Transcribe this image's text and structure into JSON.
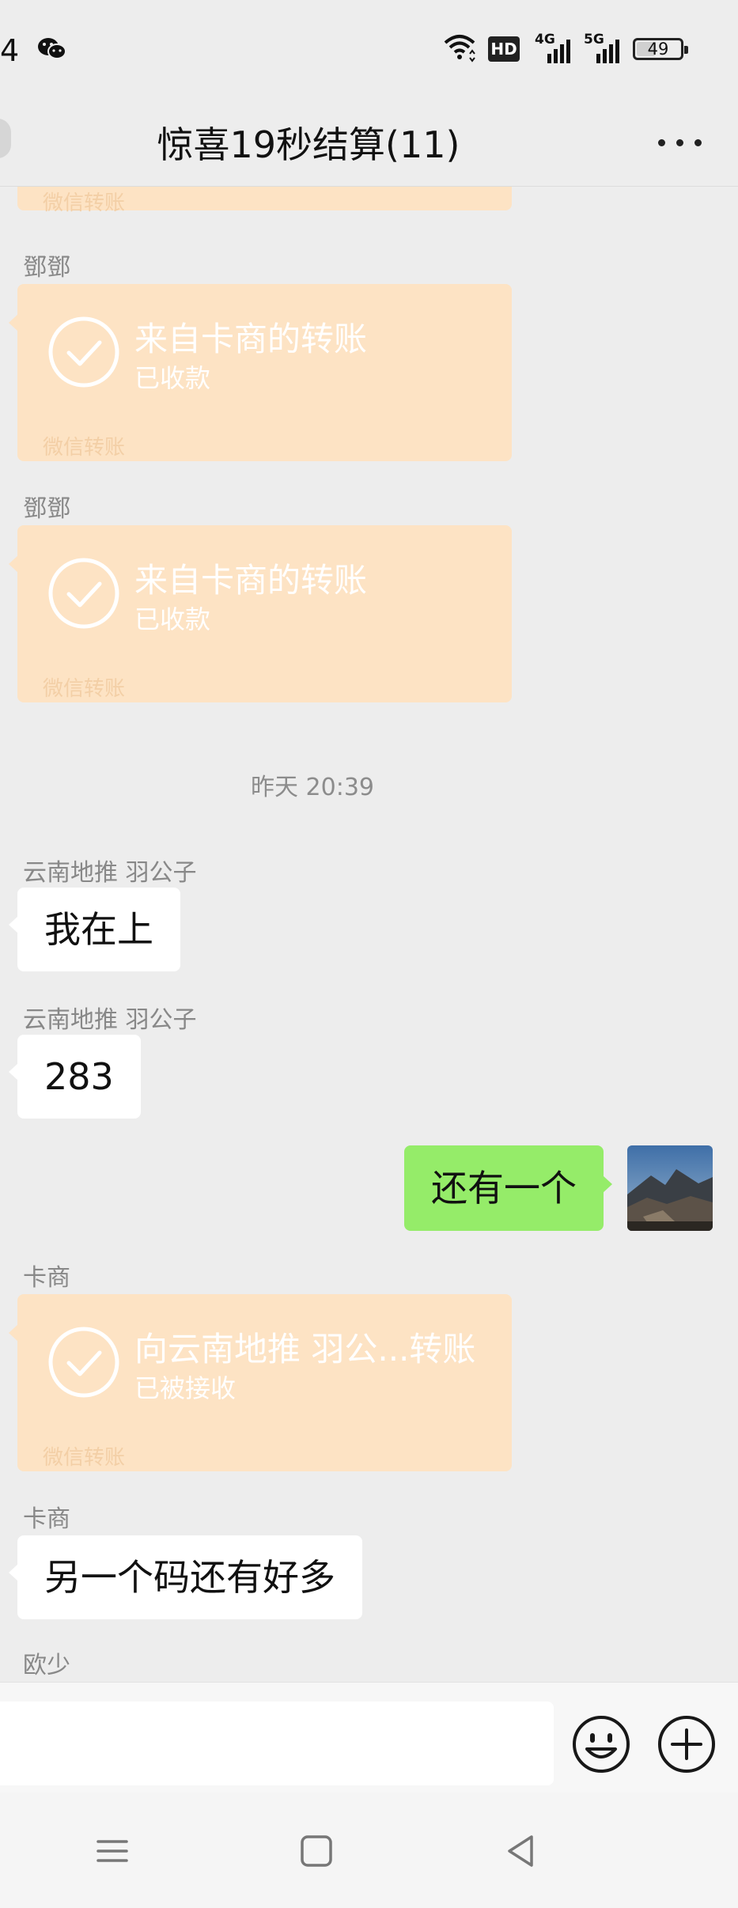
{
  "status_bar": {
    "time": "4",
    "hd_label": "HD",
    "signal_4g": "4G",
    "signal_5g": "5G",
    "battery_level": 49,
    "battery_text": "49"
  },
  "header": {
    "title": "惊喜19秒结算(11)"
  },
  "messages": {
    "top_transfer_footer": "微信转账",
    "m1": {
      "sender": "鄧鄧",
      "title": "来自卡商的转账",
      "status": "已收款",
      "footer": "微信转账"
    },
    "m2": {
      "sender": "鄧鄧",
      "title": "来自卡商的转账",
      "status": "已收款",
      "footer": "微信转账"
    },
    "timestamp": "昨天 20:39",
    "m3": {
      "sender": "云南地推  羽公子",
      "text": "我在上"
    },
    "m4": {
      "sender": "云南地推  羽公子",
      "text": "283"
    },
    "m5": {
      "text": "还有一个"
    },
    "m6": {
      "sender": "卡商",
      "title": "向云南地推  羽公...转账",
      "status": "已被接收",
      "footer": "微信转账"
    },
    "m7": {
      "sender": "卡商",
      "text": "另一个码还有好多"
    },
    "m8": {
      "sender": "欧少"
    }
  },
  "colors": {
    "background": "#ededed",
    "transfer_bubble": "#fde3c4",
    "my_bubble": "#95ec69"
  }
}
